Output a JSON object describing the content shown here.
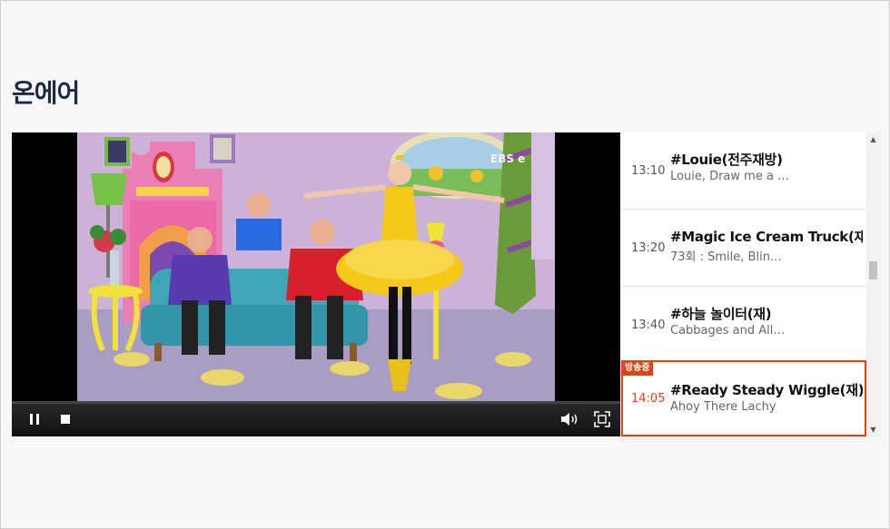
{
  "page": {
    "title": "온에어"
  },
  "player": {
    "channel_logo": "EBS e",
    "controls": [
      "pause-icon",
      "stop-icon",
      "volume-icon",
      "fullscreen-icon"
    ]
  },
  "schedule": {
    "live_badge": "방송중",
    "items": [
      {
        "time": "13:10",
        "title": "#Louie(전주재방)",
        "subtitle": "Louie, Draw me a …",
        "live": false
      },
      {
        "time": "13:20",
        "title": "#Magic Ice Cream Truck(재)",
        "subtitle": "73회 : Smile, Blin…",
        "live": false
      },
      {
        "time": "13:40",
        "title": "#하늘 놀이터(재)",
        "subtitle": "Cabbages and All…",
        "live": false
      },
      {
        "time": "14:05",
        "title": "#Ready Steady Wiggle(재)",
        "subtitle": "Ahoy There Lachy",
        "live": true
      }
    ]
  },
  "colors": {
    "accent": "#e8411a",
    "title": "#1c2a44"
  }
}
